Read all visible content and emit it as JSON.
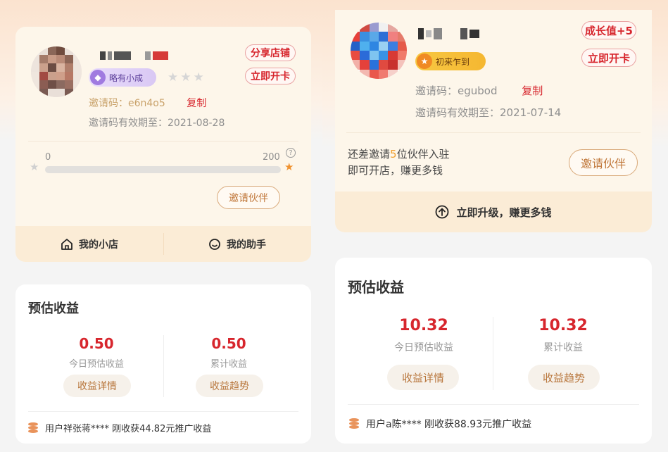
{
  "left": {
    "user": {
      "level_badge": "略有小成",
      "invite_code_label": "邀请码：",
      "invite_code": "e6n4o5",
      "copy_label": "复制",
      "expiry_label": "邀请码有效期至：",
      "expiry_date": "2021-08-28"
    },
    "share_button": "分享店铺",
    "open_card_button": "立即开卡",
    "progress": {
      "min_label": "0",
      "max_label": "200",
      "fraction": 0,
      "help_icon": "question-circle-icon"
    },
    "invite_partner_button": "邀请伙伴",
    "nav": {
      "my_shop": "我的小店",
      "my_assistant": "我的助手"
    },
    "earnings": {
      "title": "预估收益",
      "today_value": "0.50",
      "today_label": "今日预估收益",
      "total_value": "0.50",
      "total_label": "累计收益",
      "detail_button": "收益详情",
      "trend_button": "收益趋势",
      "notice": "用户祥张蒋**** 刚收获44.82元推广收益"
    }
  },
  "right": {
    "user": {
      "level_badge": "初来乍到",
      "invite_code_label": "邀请码：",
      "invite_code": "egubod",
      "copy_label": "复制",
      "expiry_label": "邀请码有效期至：",
      "expiry_date": "2021-07-14"
    },
    "growth_button": "成长值+5",
    "open_card_button": "立即开卡",
    "invite_hint": {
      "pre": "还差邀请",
      "count": "5",
      "post": "位伙伴入驻",
      "line2": "即可开店，赚更多钱"
    },
    "invite_partner_button": "邀请伙伴",
    "upgrade_label": "立即升级，赚更多钱",
    "earnings": {
      "title": "预估收益",
      "today_value": "10.32",
      "today_label": "今日预估收益",
      "total_value": "10.32",
      "total_label": "累计收益",
      "detail_button": "收益详情",
      "trend_button": "收益趋势",
      "notice": "用户a陈**** 刚收获88.93元推广收益"
    }
  },
  "colors": {
    "accent_red": "#d7262d",
    "gold_text": "#c9a26a",
    "card_bg": "#fdf6ea",
    "nav_bg": "#fbecd6"
  }
}
